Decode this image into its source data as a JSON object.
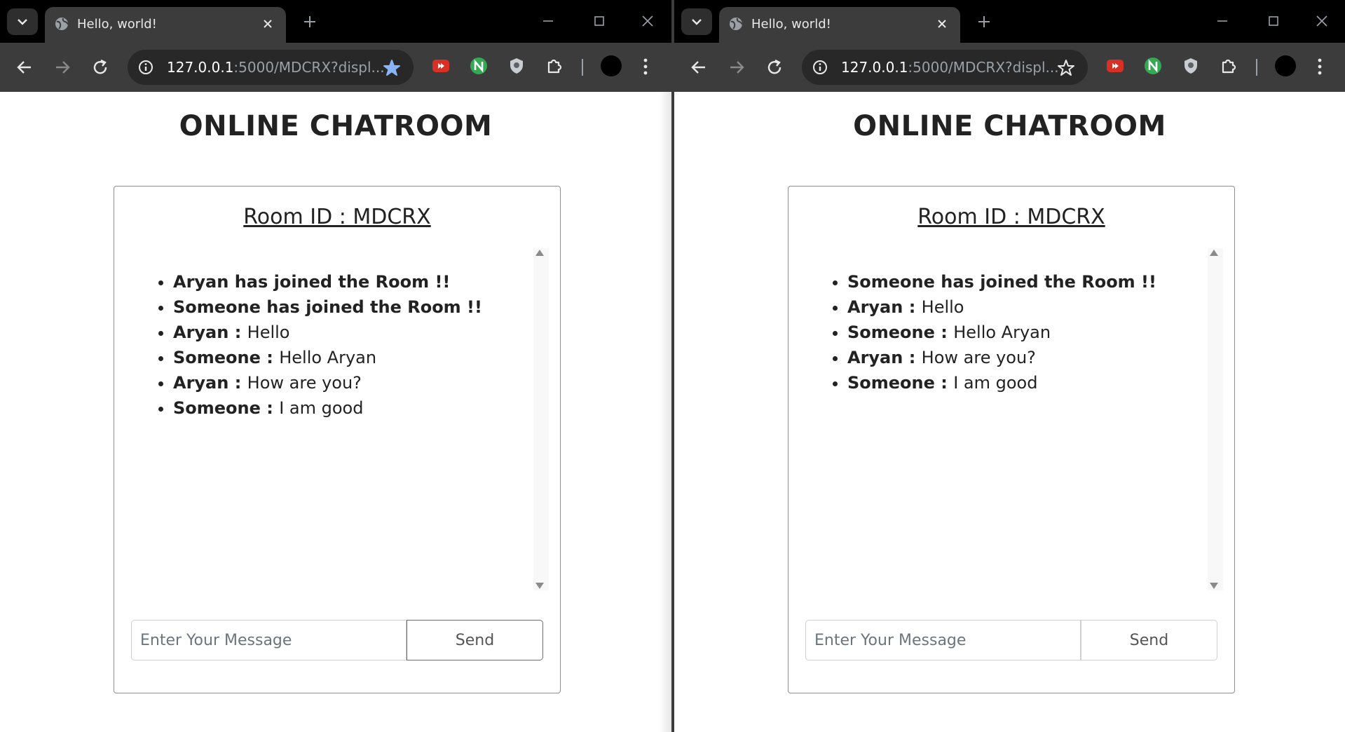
{
  "windows": [
    {
      "tab_title": "Hello, world!",
      "url_host": "127.0.0.1",
      "url_rest": ":5000/MDCRX?displ...",
      "bookmarked": true,
      "heading": "ONLINE CHATROOM",
      "room_id": "Room ID : MDCRX",
      "messages": [
        {
          "who": "Aryan has joined the Room !!",
          "text": ""
        },
        {
          "who": "Someone has joined the Room !!",
          "text": ""
        },
        {
          "who": "Aryan : ",
          "text": "Hello"
        },
        {
          "who": "Someone : ",
          "text": "Hello Aryan"
        },
        {
          "who": "Aryan : ",
          "text": "How are you?"
        },
        {
          "who": "Someone : ",
          "text": "I am good"
        }
      ],
      "input_placeholder": "Enter Your Message",
      "send_label": "Send"
    },
    {
      "tab_title": "Hello, world!",
      "url_host": "127.0.0.1",
      "url_rest": ":5000/MDCRX?displ...",
      "bookmarked": false,
      "heading": "ONLINE CHATROOM",
      "room_id": "Room ID : MDCRX",
      "messages": [
        {
          "who": "Someone has joined the Room !!",
          "text": ""
        },
        {
          "who": "Aryan : ",
          "text": "Hello"
        },
        {
          "who": "Someone : ",
          "text": "Hello Aryan"
        },
        {
          "who": "Aryan : ",
          "text": "How are you?"
        },
        {
          "who": "Someone : ",
          "text": "I am good"
        }
      ],
      "input_placeholder": "Enter Your Message",
      "send_label": "Send"
    }
  ],
  "colors": {
    "tab_bar": "#000000",
    "toolbar": "#3c3c3c",
    "omnibox": "#282828",
    "bookmark_star_active": "#8ab4f8",
    "text": "#222222"
  },
  "icons": [
    "tab-search-icon",
    "globe-icon",
    "close-icon",
    "new-tab-icon",
    "minimize-icon",
    "maximize-icon",
    "back-icon",
    "forward-icon",
    "reload-icon",
    "site-info-icon",
    "bookmark-star-icon",
    "extension-youtube-icon",
    "extension-n-icon",
    "extension-shield-icon",
    "extensions-puzzle-icon",
    "profile-avatar",
    "menu-kebab-icon"
  ]
}
